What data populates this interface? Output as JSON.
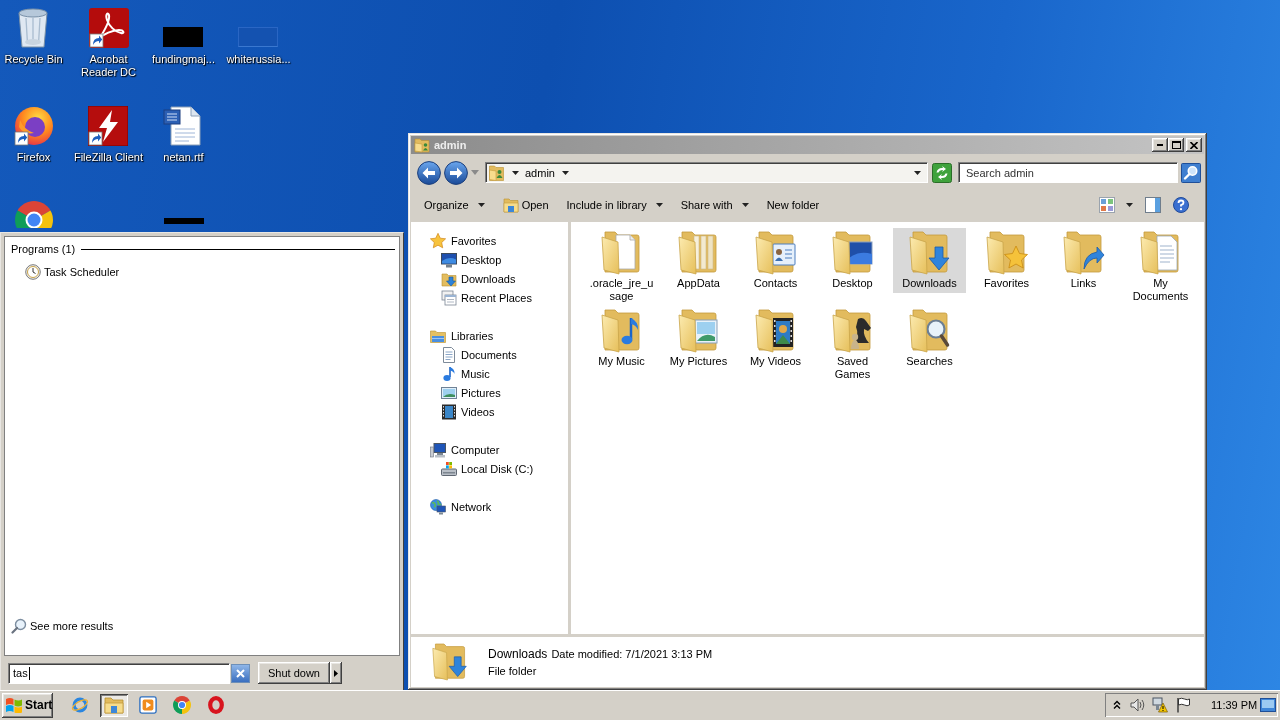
{
  "desktop": {
    "columns": [
      [
        {
          "label": "Recycle Bin",
          "kind": "recycle-bin",
          "shortcut": false
        },
        {
          "label": "Firefox",
          "kind": "firefox",
          "shortcut": true
        },
        {
          "kind": "chrome"
        }
      ],
      [
        {
          "label": "Acrobat Reader DC",
          "kind": "acrobat",
          "shortcut": true
        },
        {
          "label": "FileZilla Client",
          "kind": "filezilla",
          "shortcut": true
        }
      ],
      [
        {
          "label": "fundingmaj...",
          "kind": "dark-thumbnail",
          "shortcut": false
        },
        {
          "label": "netan.rtf",
          "kind": "word-doc",
          "shortcut": false
        },
        {
          "kind": "dark-thumbnail"
        }
      ],
      [
        {
          "label": "whiterussia...",
          "kind": "blank-thumbnail",
          "shortcut": false
        }
      ]
    ]
  },
  "start_menu": {
    "sections": [
      {
        "title": "Programs (1)",
        "items": [
          {
            "label": "Task Scheduler",
            "kind": "clock"
          }
        ]
      }
    ],
    "more_results": "See more results",
    "search": {
      "value": "tas"
    },
    "shutdown": "Shut down"
  },
  "explorer": {
    "title": "admin",
    "address": {
      "path": [
        "admin"
      ]
    },
    "search": {
      "placeholder": "Search admin"
    },
    "toolbar": [
      {
        "label": "Organize",
        "kind": "menu"
      },
      {
        "label": "Open",
        "kind": "icon-button"
      },
      {
        "label": "Include in library",
        "kind": "menu"
      },
      {
        "label": "Share with",
        "kind": "menu"
      },
      {
        "label": "New folder",
        "kind": "button"
      }
    ],
    "nav": [
      {
        "label": "Favorites",
        "kind": "star",
        "children": [
          {
            "label": "Desktop",
            "kind": "desktop"
          },
          {
            "label": "Downloads",
            "kind": "downloads"
          },
          {
            "label": "Recent Places",
            "kind": "recent"
          }
        ]
      },
      {
        "label": "Libraries",
        "kind": "library",
        "children": [
          {
            "label": "Documents",
            "kind": "documents"
          },
          {
            "label": "Music",
            "kind": "music"
          },
          {
            "label": "Pictures",
            "kind": "pictures"
          },
          {
            "label": "Videos",
            "kind": "videos"
          }
        ]
      },
      {
        "label": "Computer",
        "kind": "computer",
        "children": [
          {
            "label": "Local Disk (C:)",
            "kind": "disk"
          }
        ]
      },
      {
        "label": "Network",
        "kind": "network"
      }
    ],
    "items": [
      {
        "label": ".oracle_jre_usage",
        "kind": "file",
        "selected": false
      },
      {
        "label": "AppData",
        "kind": "plain",
        "selected": false
      },
      {
        "label": "Contacts",
        "kind": "contacts",
        "selected": false
      },
      {
        "label": "Desktop",
        "kind": "desktop",
        "selected": false
      },
      {
        "label": "Downloads",
        "kind": "downloads",
        "selected": true
      },
      {
        "label": "Favorites",
        "kind": "favorites",
        "selected": false
      },
      {
        "label": "Links",
        "kind": "links",
        "selected": false
      },
      {
        "label": "My Documents",
        "kind": "documents",
        "selected": false
      },
      {
        "label": "My Music",
        "kind": "music",
        "selected": false
      },
      {
        "label": "My Pictures",
        "kind": "pictures",
        "selected": false
      },
      {
        "label": "My Videos",
        "kind": "videos",
        "selected": false
      },
      {
        "label": "Saved Games",
        "kind": "games",
        "selected": false
      },
      {
        "label": "Searches",
        "kind": "searches",
        "selected": false
      }
    ],
    "details": {
      "kind": "downloads",
      "name": "Downloads",
      "modified": "Date modified: 7/1/2021 3:13 PM",
      "type": "File folder"
    }
  },
  "taskbar": {
    "start": "Start",
    "apps": [
      {
        "kind": "ie",
        "active": false
      },
      {
        "kind": "explorer",
        "active": true
      },
      {
        "kind": "media",
        "active": false
      },
      {
        "kind": "chrome",
        "active": false
      },
      {
        "kind": "opera",
        "active": false
      }
    ],
    "clock": "11:39 PM"
  }
}
